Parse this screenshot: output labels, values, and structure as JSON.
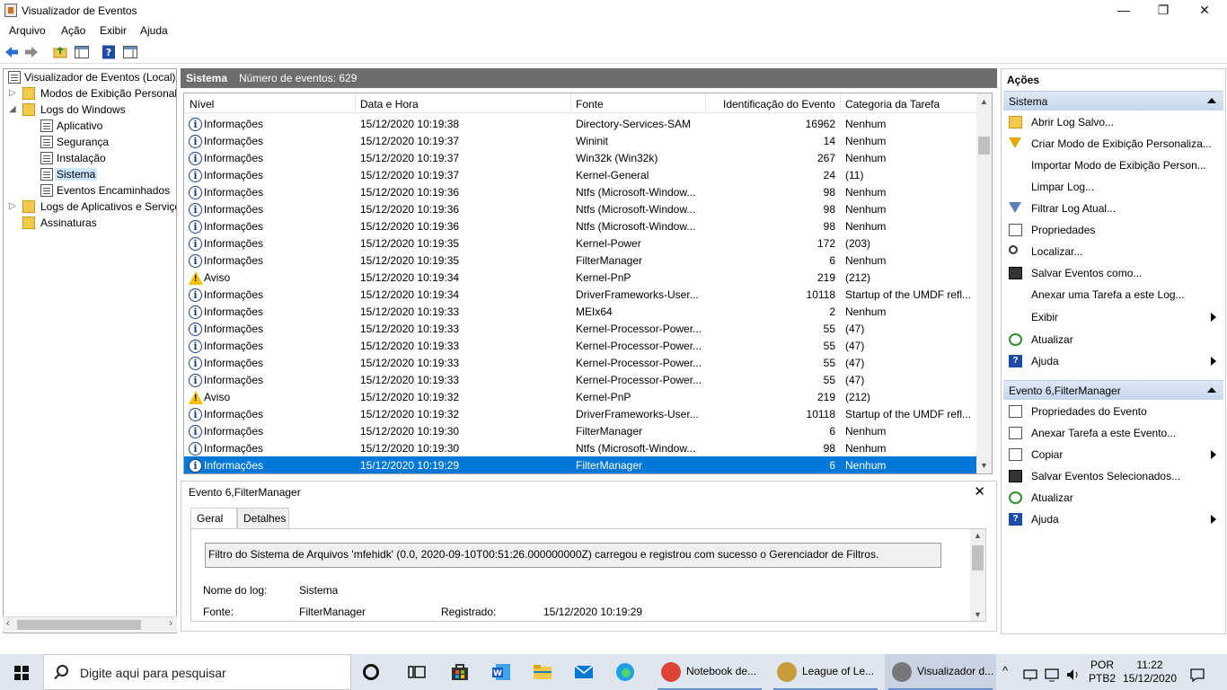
{
  "window": {
    "title": "Visualizador de Eventos",
    "minimize": "—",
    "maximize": "❐",
    "close": "✕"
  },
  "menu": [
    "Arquivo",
    "Ação",
    "Exibir",
    "Ajuda"
  ],
  "tree": {
    "root": "Visualizador de Eventos (Local)",
    "custom_views": "Modos de Exibição Personali...",
    "windows_logs": "Logs do Windows",
    "app": "Aplicativo",
    "security": "Segurança",
    "setup": "Instalação",
    "system": "Sistema",
    "forwarded": "Eventos Encaminhados",
    "app_services": "Logs de Aplicativos e Serviço...",
    "subscriptions": "Assinaturas"
  },
  "center": {
    "log_name": "Sistema",
    "count_label": "Número de eventos: 629"
  },
  "columns": {
    "level": "Nível",
    "date": "Data e Hora",
    "source": "Fonte",
    "id": "Identificação do Evento",
    "category": "Categoria da Tarefa"
  },
  "events": [
    {
      "level": "Informações",
      "icon": "info",
      "date": "15/12/2020 10:19:38",
      "source": "Directory-Services-SAM",
      "id": "16962",
      "category": "Nenhum"
    },
    {
      "level": "Informações",
      "icon": "info",
      "date": "15/12/2020 10:19:37",
      "source": "Wininit",
      "id": "14",
      "category": "Nenhum"
    },
    {
      "level": "Informações",
      "icon": "info",
      "date": "15/12/2020 10:19:37",
      "source": "Win32k (Win32k)",
      "id": "267",
      "category": "Nenhum"
    },
    {
      "level": "Informações",
      "icon": "info",
      "date": "15/12/2020 10:19:37",
      "source": "Kernel-General",
      "id": "24",
      "category": "(11)"
    },
    {
      "level": "Informações",
      "icon": "info",
      "date": "15/12/2020 10:19:36",
      "source": "Ntfs (Microsoft-Window...",
      "id": "98",
      "category": "Nenhum"
    },
    {
      "level": "Informações",
      "icon": "info",
      "date": "15/12/2020 10:19:36",
      "source": "Ntfs (Microsoft-Window...",
      "id": "98",
      "category": "Nenhum"
    },
    {
      "level": "Informações",
      "icon": "info",
      "date": "15/12/2020 10:19:36",
      "source": "Ntfs (Microsoft-Window...",
      "id": "98",
      "category": "Nenhum"
    },
    {
      "level": "Informações",
      "icon": "info",
      "date": "15/12/2020 10:19:35",
      "source": "Kernel-Power",
      "id": "172",
      "category": "(203)"
    },
    {
      "level": "Informações",
      "icon": "info",
      "date": "15/12/2020 10:19:35",
      "source": "FilterManager",
      "id": "6",
      "category": "Nenhum"
    },
    {
      "level": "Aviso",
      "icon": "warning",
      "date": "15/12/2020 10:19:34",
      "source": "Kernel-PnP",
      "id": "219",
      "category": "(212)"
    },
    {
      "level": "Informações",
      "icon": "info",
      "date": "15/12/2020 10:19:34",
      "source": "DriverFrameworks-User...",
      "id": "10118",
      "category": "Startup of the UMDF refl..."
    },
    {
      "level": "Informações",
      "icon": "info",
      "date": "15/12/2020 10:19:33",
      "source": "MEIx64",
      "id": "2",
      "category": "Nenhum"
    },
    {
      "level": "Informações",
      "icon": "info",
      "date": "15/12/2020 10:19:33",
      "source": "Kernel-Processor-Power...",
      "id": "55",
      "category": "(47)"
    },
    {
      "level": "Informações",
      "icon": "info",
      "date": "15/12/2020 10:19:33",
      "source": "Kernel-Processor-Power...",
      "id": "55",
      "category": "(47)"
    },
    {
      "level": "Informações",
      "icon": "info",
      "date": "15/12/2020 10:19:33",
      "source": "Kernel-Processor-Power...",
      "id": "55",
      "category": "(47)"
    },
    {
      "level": "Informações",
      "icon": "info",
      "date": "15/12/2020 10:19:33",
      "source": "Kernel-Processor-Power...",
      "id": "55",
      "category": "(47)"
    },
    {
      "level": "Aviso",
      "icon": "warning",
      "date": "15/12/2020 10:19:32",
      "source": "Kernel-PnP",
      "id": "219",
      "category": "(212)"
    },
    {
      "level": "Informações",
      "icon": "info",
      "date": "15/12/2020 10:19:32",
      "source": "DriverFrameworks-User...",
      "id": "10118",
      "category": "Startup of the UMDF refl..."
    },
    {
      "level": "Informações",
      "icon": "info",
      "date": "15/12/2020 10:19:30",
      "source": "FilterManager",
      "id": "6",
      "category": "Nenhum"
    },
    {
      "level": "Informações",
      "icon": "info",
      "date": "15/12/2020 10:19:30",
      "source": "Ntfs (Microsoft-Window...",
      "id": "98",
      "category": "Nenhum"
    },
    {
      "level": "Informações",
      "icon": "info",
      "date": "15/12/2020 10:19:29",
      "source": "FilterManager",
      "id": "6",
      "category": "Nenhum",
      "selected": true
    }
  ],
  "detail": {
    "title": "Evento 6,FilterManager",
    "close": "✕",
    "tab_general": "Geral",
    "tab_details": "Detalhes",
    "description": "Filtro do Sistema de Arquivos 'mfehidk' (0.0, 2020-09-10T00:51:26.000000000Z) carregou e registrou com sucesso o Gerenciador de Filtros.",
    "log_name_label": "Nome do log:",
    "log_name_value": "Sistema",
    "source_label": "Fonte:",
    "source_value": "FilterManager",
    "logged_label": "Registrado:",
    "logged_value": "15/12/2020 10:19:29"
  },
  "actions": {
    "header": "Ações",
    "section1": "Sistema",
    "items1": [
      {
        "label": "Abrir Log Salvo...",
        "icon": "open-folder-icon"
      },
      {
        "label": "Criar Modo de Exibição Personaliza...",
        "icon": "filter-create-icon"
      },
      {
        "label": "Importar Modo de Exibição Person...",
        "icon": ""
      },
      {
        "label": "Limpar Log...",
        "icon": ""
      },
      {
        "label": "Filtrar Log Atual...",
        "icon": "filter-icon"
      },
      {
        "label": "Propriedades",
        "icon": "properties-icon"
      },
      {
        "label": "Localizar...",
        "icon": "find-icon"
      },
      {
        "label": "Salvar Eventos como...",
        "icon": "save-icon"
      },
      {
        "label": "Anexar uma Tarefa a este Log...",
        "icon": ""
      },
      {
        "label": "Exibir",
        "icon": "",
        "submenu": true
      },
      {
        "label": "Atualizar",
        "icon": "refresh-icon"
      },
      {
        "label": "Ajuda",
        "icon": "help-icon",
        "submenu": true
      }
    ],
    "section2": "Evento 6,FilterManager",
    "items2": [
      {
        "label": "Propriedades do Evento",
        "icon": "properties-icon"
      },
      {
        "label": "Anexar Tarefa a este Evento...",
        "icon": "task-icon"
      },
      {
        "label": "Copiar",
        "icon": "copy-icon",
        "submenu": true
      },
      {
        "label": "Salvar Eventos Selecionados...",
        "icon": "save-icon"
      },
      {
        "label": "Atualizar",
        "icon": "refresh-icon"
      },
      {
        "label": "Ajuda",
        "icon": "help-icon",
        "submenu": true
      }
    ]
  },
  "taskbar": {
    "search_placeholder": "Digite aqui para pesquisar",
    "apps": [
      {
        "title": "Notebook de...",
        "color": "#db4437"
      },
      {
        "title": "League of Le...",
        "color": "#c89b3c"
      },
      {
        "title": "Visualizador d...",
        "color": "#777777"
      }
    ],
    "lang1": "POR",
    "lang2": "PTB2",
    "time": "11:22",
    "date": "15/12/2020"
  }
}
